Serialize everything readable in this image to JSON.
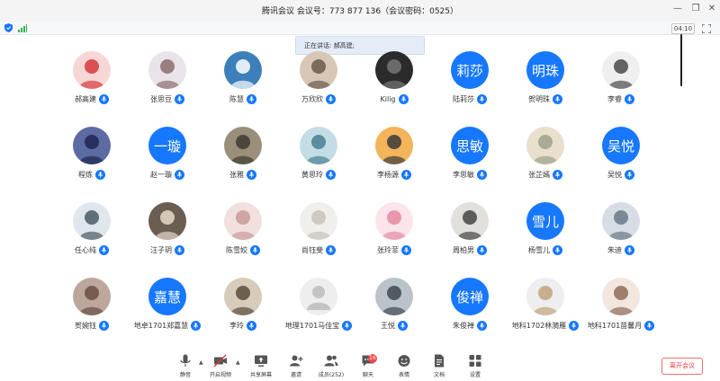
{
  "window": {
    "title": "腾讯会议 会议号：773 877 136（会议密码：0525）",
    "controls": {
      "minimize": "—",
      "restore": "❐",
      "close": "✕"
    }
  },
  "status": {
    "timer": "04:10",
    "shield_icon": "shield-icon",
    "signal_icon": "signal-icon",
    "fullscreen_icon": "fullscreen-icon"
  },
  "speaking": "正在讲话: 郝高建;",
  "colors": {
    "accent": "#1677ff",
    "leave": "#e23b3b",
    "badge": "#f04848"
  },
  "participants": [
    {
      "name": "郝高建",
      "avatar": "photo"
    },
    {
      "name": "张思豆",
      "avatar": "photo"
    },
    {
      "name": "陈慧",
      "avatar": "photo"
    },
    {
      "name": "万欣欣",
      "avatar": "photo"
    },
    {
      "name": "Kilig",
      "avatar": "photo"
    },
    {
      "name": "陆莉莎",
      "avatar": "text",
      "avatar_text": "莉莎"
    },
    {
      "name": "贺明珠",
      "avatar": "text",
      "avatar_text": "明珠"
    },
    {
      "name": "李睿",
      "avatar": "photo"
    },
    {
      "name": "程炼",
      "avatar": "photo"
    },
    {
      "name": "赵一璇",
      "avatar": "text",
      "avatar_text": "一璇"
    },
    {
      "name": "张雅",
      "avatar": "photo"
    },
    {
      "name": "黄思玲",
      "avatar": "photo"
    },
    {
      "name": "李杨源",
      "avatar": "photo"
    },
    {
      "name": "李思敏",
      "avatar": "text",
      "avatar_text": "思敏"
    },
    {
      "name": "张芷嫣",
      "avatar": "photo"
    },
    {
      "name": "吴悦",
      "avatar": "text",
      "avatar_text": "吴悦"
    },
    {
      "name": "任心纯",
      "avatar": "photo"
    },
    {
      "name": "汪子玥",
      "avatar": "photo"
    },
    {
      "name": "陈雪姣",
      "avatar": "photo"
    },
    {
      "name": "尚钰斐",
      "avatar": "photo"
    },
    {
      "name": "张玲菲",
      "avatar": "photo"
    },
    {
      "name": "周柏男",
      "avatar": "photo"
    },
    {
      "name": "杨雪儿",
      "avatar": "text",
      "avatar_text": "雪儿"
    },
    {
      "name": "朱迪",
      "avatar": "photo"
    },
    {
      "name": "贺婉钰",
      "avatar": "photo"
    },
    {
      "name": "地卓1701郑嘉慧",
      "avatar": "text",
      "avatar_text": "嘉慧"
    },
    {
      "name": "李玲",
      "avatar": "photo"
    },
    {
      "name": "地理1701马佳宝",
      "avatar": "default"
    },
    {
      "name": "王悦",
      "avatar": "photo"
    },
    {
      "name": "朱俊禅",
      "avatar": "text",
      "avatar_text": "俊禅"
    },
    {
      "name": "地科1702林漪雁",
      "avatar": "photo"
    },
    {
      "name": "地科1701苗馨月",
      "avatar": "photo"
    }
  ],
  "toolbar": {
    "mute": "静音",
    "video": "开启视频",
    "share": "共享屏幕",
    "invite": "邀请",
    "members": "成员(252)",
    "chat": "聊天",
    "chat_badge": "16",
    "reactions": "表情",
    "docs": "文档",
    "settings": "设置",
    "leave": "离开会议"
  }
}
